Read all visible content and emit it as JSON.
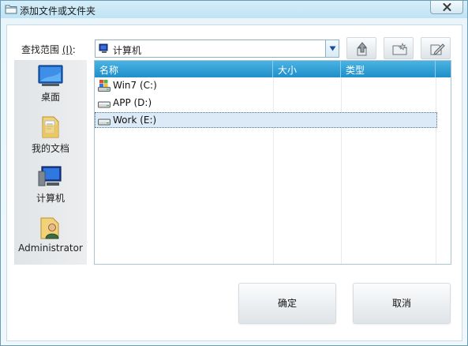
{
  "window": {
    "title": "添加文件或文件夹",
    "icon": "folder-icon",
    "accent_color": "#2a9bd3"
  },
  "look_in": {
    "label": "查找范围",
    "accelerator": "(I)",
    "selected_value": "计算机"
  },
  "toolbar": [
    "up-one-level-icon",
    "new-folder-icon",
    "view-menu-icon"
  ],
  "places": [
    {
      "label": "桌面",
      "icon": "desktop-icon"
    },
    {
      "label": "我的文档",
      "icon": "documents-folder-icon"
    },
    {
      "label": "计算机",
      "icon": "computer-icon"
    },
    {
      "label": "Administrator",
      "icon": "user-folder-icon"
    }
  ],
  "columns": [
    "名称",
    "大小",
    "类型"
  ],
  "drives": [
    {
      "label": "Win7 (C:)",
      "icon": "system-drive-icon"
    },
    {
      "label": "APP (D:)",
      "icon": "drive-icon"
    },
    {
      "label": "Work (E:)",
      "icon": "drive-icon",
      "selected": true
    }
  ],
  "buttons": {
    "ok": "确定",
    "cancel": "取消"
  }
}
